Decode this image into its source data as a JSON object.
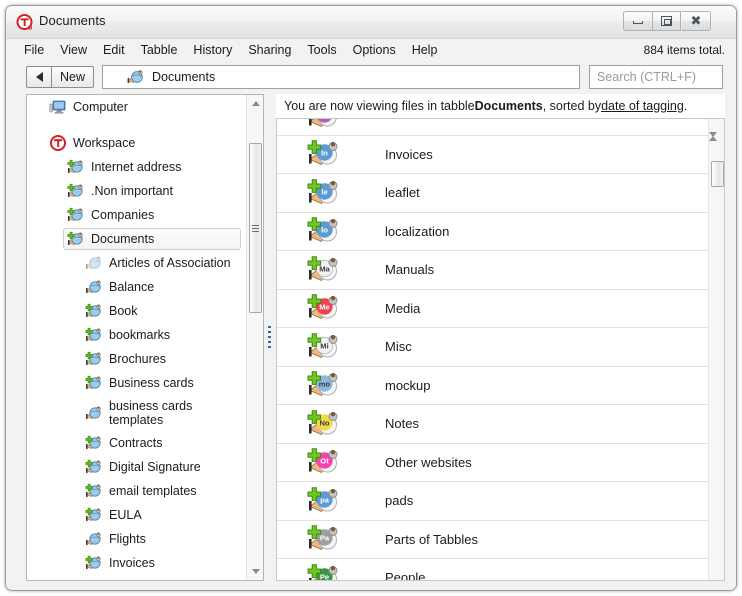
{
  "window": {
    "title": "Documents",
    "app_icon": "tabbles-circle-t-icon",
    "controls": {
      "minimize": "minimize-icon",
      "maximize": "maximize-icon",
      "close": "close-icon"
    }
  },
  "menubar": {
    "items": [
      {
        "label": "File"
      },
      {
        "label": "View"
      },
      {
        "label": "Edit"
      },
      {
        "label": "Tabble"
      },
      {
        "label": "History"
      },
      {
        "label": "Sharing"
      },
      {
        "label": "Tools"
      },
      {
        "label": "Options"
      },
      {
        "label": "Help"
      }
    ],
    "items_total": "884 items total."
  },
  "toolbar": {
    "back_label": "back-arrow",
    "new_label": "New",
    "address_icon": "tag-globe-icon",
    "address_value": "Documents",
    "search_placeholder": "Search (CTRL+F)",
    "search_value": ""
  },
  "sidebar": {
    "items": [
      {
        "label": "Computer",
        "level": 0,
        "icon": "computer-icon",
        "selected": false
      },
      {
        "label": "Workspace",
        "level": 0,
        "icon": "workspace-icon",
        "selected": false
      },
      {
        "label": "Internet address",
        "level": 1,
        "icon": "tag-globe-icon",
        "selected": false
      },
      {
        "label": ".Non important",
        "level": 1,
        "icon": "tag-icon",
        "selected": false
      },
      {
        "label": "Companies",
        "level": 1,
        "icon": "tag-icon",
        "selected": false
      },
      {
        "label": "Documents",
        "level": 1,
        "icon": "tag-icon",
        "selected": true
      },
      {
        "label": "Articles of Association",
        "level": 2,
        "icon": "tag-faded-icon",
        "selected": false
      },
      {
        "label": "Balance",
        "level": 2,
        "icon": "tag-plain-icon",
        "selected": false
      },
      {
        "label": "Book",
        "level": 2,
        "icon": "tag-icon",
        "selected": false
      },
      {
        "label": "bookmarks",
        "level": 2,
        "icon": "tag-icon",
        "selected": false
      },
      {
        "label": "Brochures",
        "level": 2,
        "icon": "tag-icon",
        "selected": false
      },
      {
        "label": "Business cards",
        "level": 2,
        "icon": "tag-icon",
        "selected": false
      },
      {
        "label": "business cards templates",
        "level": 2,
        "icon": "tag-plain-icon",
        "selected": false,
        "tall": true
      },
      {
        "label": "Contracts",
        "level": 2,
        "icon": "tag-icon",
        "selected": false
      },
      {
        "label": "Digital Signature",
        "level": 2,
        "icon": "tag-icon",
        "selected": false
      },
      {
        "label": "email templates",
        "level": 2,
        "icon": "tag-icon",
        "selected": false
      },
      {
        "label": "EULA",
        "level": 2,
        "icon": "tag-icon",
        "selected": false
      },
      {
        "label": "Flights",
        "level": 2,
        "icon": "tag-plain-icon",
        "selected": false
      },
      {
        "label": "Invoices",
        "level": 2,
        "icon": "tag-icon",
        "selected": false
      }
    ]
  },
  "content": {
    "status_prefix": "You are now viewing files in tabble ",
    "status_tabble": "Documents",
    "status_middle": ", sorted by ",
    "status_link": "date of tagging",
    "status_suffix": ".",
    "rows": [
      {
        "label": "",
        "initials": "",
        "color": "#b45ec0",
        "clipped": true
      },
      {
        "label": "Invoices",
        "initials": "In",
        "color": "#5b9bd5"
      },
      {
        "label": "leaflet",
        "initials": "le",
        "color": "#5b9bd5"
      },
      {
        "label": "localization",
        "initials": "lo",
        "color": "#5b9bd5"
      },
      {
        "label": "Manuals",
        "initials": "Ma",
        "color": "#f2f2f2"
      },
      {
        "label": "Media",
        "initials": "Me",
        "color": "#ef4150"
      },
      {
        "label": "Misc",
        "initials": "Mi",
        "color": "#f2f2f2"
      },
      {
        "label": "mockup",
        "initials": "mo",
        "color": "#8fb8de"
      },
      {
        "label": "Notes",
        "initials": "No",
        "color": "#f4d94a"
      },
      {
        "label": "Other websites",
        "initials": "Ot",
        "color": "#f542b0"
      },
      {
        "label": "pads",
        "initials": "pa",
        "color": "#5b9bd5"
      },
      {
        "label": "Parts of Tabbles",
        "initials": "Pa",
        "color": "#9e9e9e"
      },
      {
        "label": "People",
        "initials": "Pe",
        "color": "#3f9448",
        "clipped_bottom": true
      }
    ]
  },
  "scrollbars": {
    "left_thumb_name": "tree-scroll-thumb",
    "right_thumb_name": "list-scroll-thumb"
  },
  "colors": {
    "accent_red": "#d3202a",
    "tag_blue": "#5b9bd5",
    "plus_green": "#62b820",
    "splitter_blue": "#3a63a8"
  }
}
